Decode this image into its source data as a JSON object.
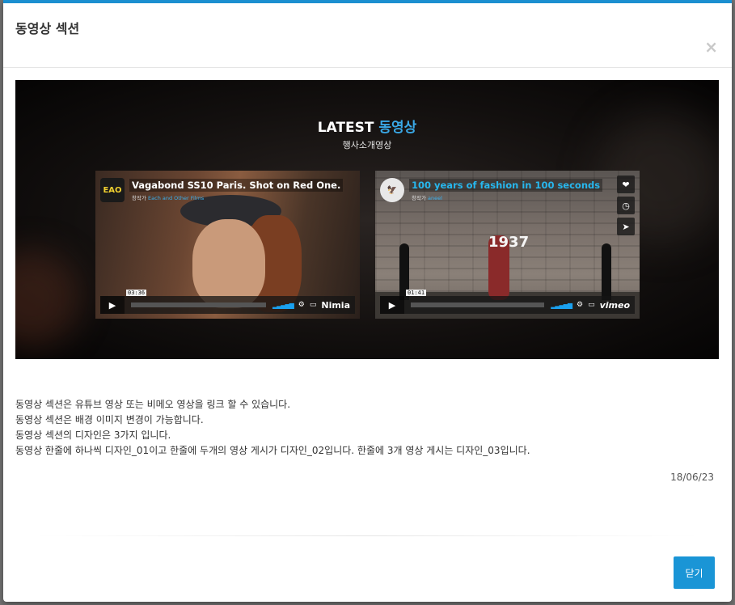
{
  "modal": {
    "title": "동영상 섹션",
    "close_icon_glyph": "×",
    "close_button_label": "닫기",
    "accent_color": "#1a95d6"
  },
  "banner": {
    "title_prefix": "LATEST",
    "title_accent": "동영상",
    "subtitle": "행사소개영상",
    "videos": [
      {
        "avatar_text": "EAO",
        "title": "Vagabond SS10 Paris. Shot on Red One.",
        "byline_prefix": "창작가",
        "byline_author": "Each and Other Films",
        "time": "03:36",
        "brand": "Nimia"
      },
      {
        "avatar_text": "🦅",
        "title": "100 years of fashion in 100 seconds",
        "byline_prefix": "창작가",
        "byline_author": "aneel",
        "overlay_text": "1937",
        "time": "01:41",
        "brand": "vimeo"
      }
    ]
  },
  "description": {
    "lines": [
      "동영상 섹션은 유튜브 영상 또는 비메오 영상을 링크 할 수 있습니다.",
      "동영상 섹션은 배경 이미지 변경이 가능합니다.",
      "동영상 섹션의 디자인은 3가지 입니다.",
      "동영상 한줄에 하나씩 디자인_01이고 한줄에 두개의 영상 게시가 디자인_02입니다. 한줄에 3개 영상 게시는 디자인_03입니다."
    ],
    "date": "18/06/23"
  }
}
